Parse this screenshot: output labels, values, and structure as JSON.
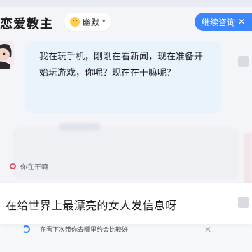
{
  "header": {
    "title": "恋爱教主",
    "mode_label": "幽默",
    "continue_label": "继续咨询"
  },
  "assistant_message": "我在玩手机，刚刚在看新闻，现在准备开始玩游戏，你呢？现在在干嘛呢？",
  "background": {
    "chip_label": "你在干嘛",
    "suggestion_label": "在看下次带你去哪里约会比较好"
  },
  "input_sheet": {
    "text": "在给世界上最漂亮的女人发信息呀"
  },
  "colors": {
    "accent": "#3c86ff",
    "bubble": "#e8f3fc"
  }
}
